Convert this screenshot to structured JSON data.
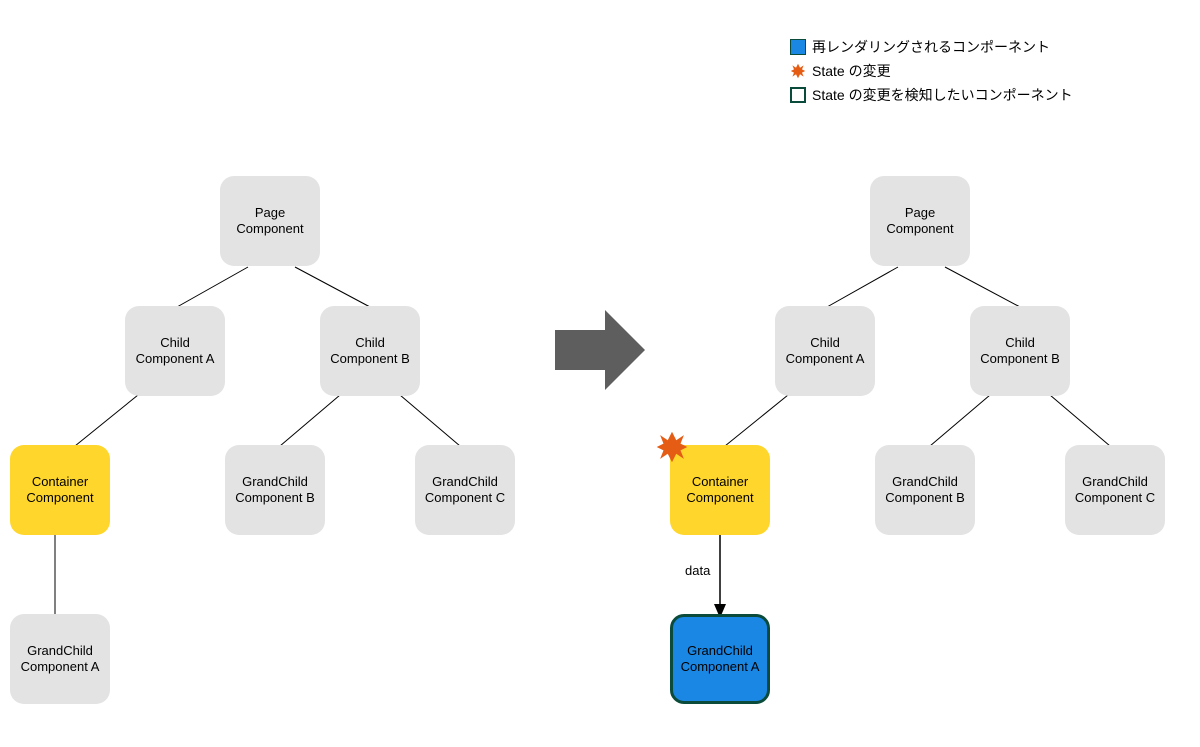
{
  "legend": {
    "rerender": "再レンダリングされるコンポーネント",
    "stateChange": "State の変更",
    "watcher": "State の変更を検知したいコンポーネント"
  },
  "left": {
    "page": "Page\nComponent",
    "childA": "Child\nComponent A",
    "childB": "Child\nComponent B",
    "container": "Container\nComponent",
    "gcA": "GrandChild\nComponent A",
    "gcB": "GrandChild\nComponent B",
    "gcC": "GrandChild\nComponent C"
  },
  "right": {
    "page": "Page\nComponent",
    "childA": "Child\nComponent A",
    "childB": "Child\nComponent B",
    "container": "Container\nComponent",
    "gcA": "GrandChild\nComponent A",
    "gcB": "GrandChild\nComponent B",
    "gcC": "GrandChild\nComponent C",
    "dataLabel": "data"
  },
  "chart_data": {
    "type": "tree",
    "description": "Two identical component trees showing React-like re-render propagation before/after a state change in Container Component.",
    "trees": [
      {
        "id": "before",
        "root": "Page Component",
        "edges": [
          [
            "Page Component",
            "Child Component A"
          ],
          [
            "Page Component",
            "Child Component B"
          ],
          [
            "Child Component A",
            "Container Component"
          ],
          [
            "Container Component",
            "GrandChild Component A"
          ],
          [
            "Child Component B",
            "GrandChild Component B"
          ],
          [
            "Child Component B",
            "GrandChild Component C"
          ]
        ],
        "highlight": {
          "Container Component": "yellow"
        }
      },
      {
        "id": "after",
        "root": "Page Component",
        "edges": [
          [
            "Page Component",
            "Child Component A"
          ],
          [
            "Page Component",
            "Child Component B"
          ],
          [
            "Child Component A",
            "Container Component"
          ],
          [
            "Container Component",
            "GrandChild Component A",
            {
              "label": "data",
              "arrow": true
            }
          ],
          [
            "Child Component B",
            "GrandChild Component B"
          ],
          [
            "Child Component B",
            "GrandChild Component C"
          ]
        ],
        "highlight": {
          "Container Component": "yellow+state-change-burst",
          "GrandChild Component A": "blue+dark-outline"
        }
      }
    ]
  }
}
